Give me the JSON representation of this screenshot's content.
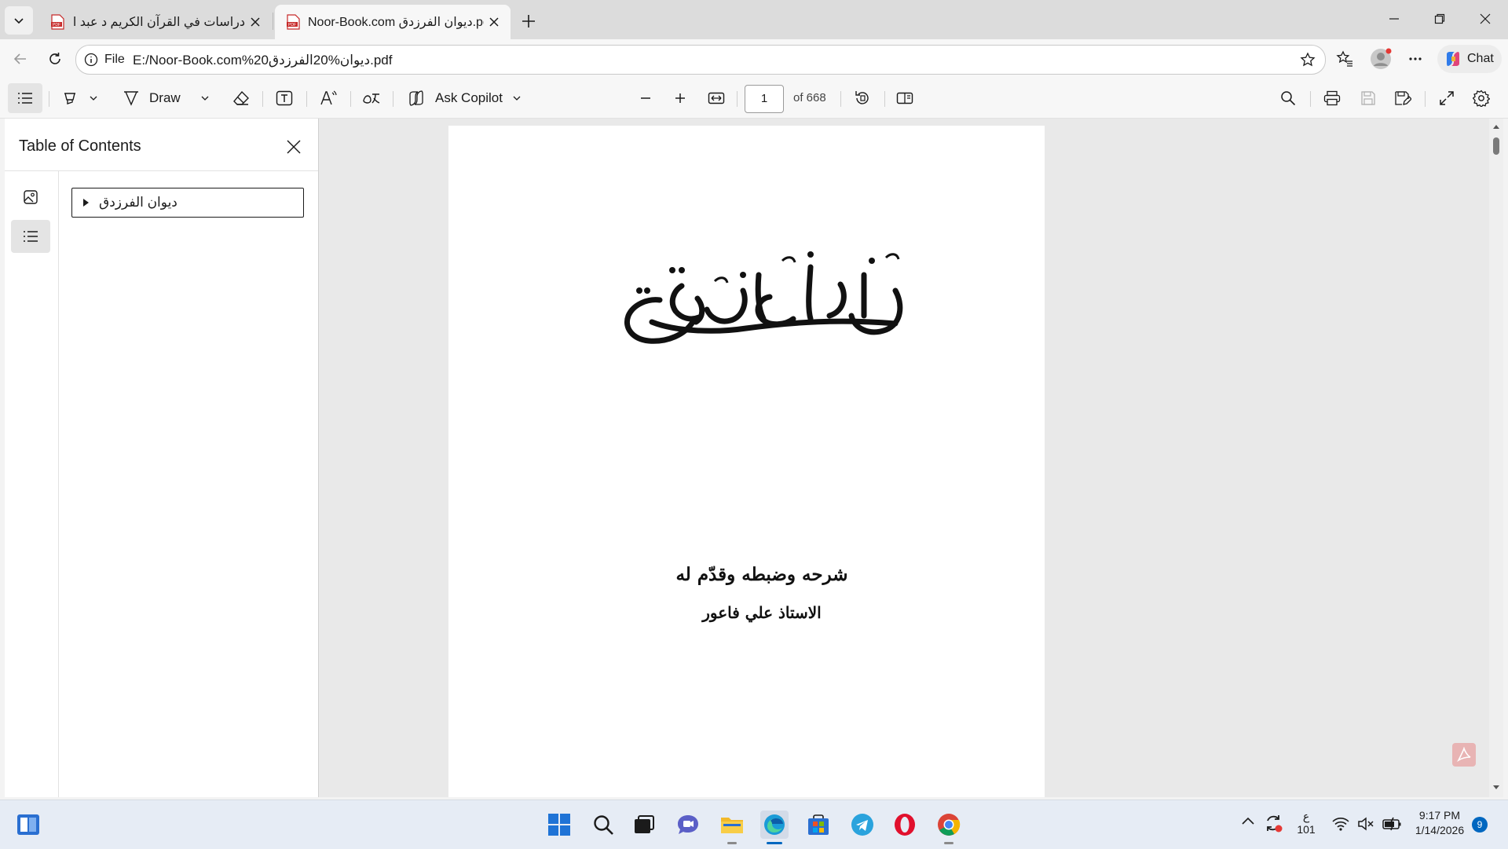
{
  "browser": {
    "tabs": [
      {
        "title": "دراسات في القرآن الكريم د عبد اللطيف",
        "active": false
      },
      {
        "title": "Noor-Book.com ديوان الفرزدق.pdf",
        "active": true
      }
    ],
    "address": {
      "scheme_label": "File",
      "url": "E:/Noor-Book.com%20ديوان%20الفرزدق.pdf"
    },
    "chat_label": "Chat"
  },
  "pdf_toolbar": {
    "draw_label": "Draw",
    "ask_copilot_label": "Ask Copilot",
    "current_page": "1",
    "page_count_label": "of 668"
  },
  "toc": {
    "title": "Table of Contents",
    "items": [
      {
        "label": "ديوان الفرزدق"
      }
    ]
  },
  "document": {
    "page_title": "ديوان الفرزدق",
    "credit_line": "شرحه وضبطه وقدّم له",
    "author_line": "الاستاذ علي فاعور"
  },
  "taskbar": {
    "lang_indicator": "ع",
    "lang_sub": "101",
    "time": "9:17 PM",
    "date": "1/14/2026",
    "notification_count": "9"
  },
  "colors": {
    "accent": "#0067c0",
    "page_bg": "#e9e9e9",
    "pdf_icon": "#c62828"
  }
}
